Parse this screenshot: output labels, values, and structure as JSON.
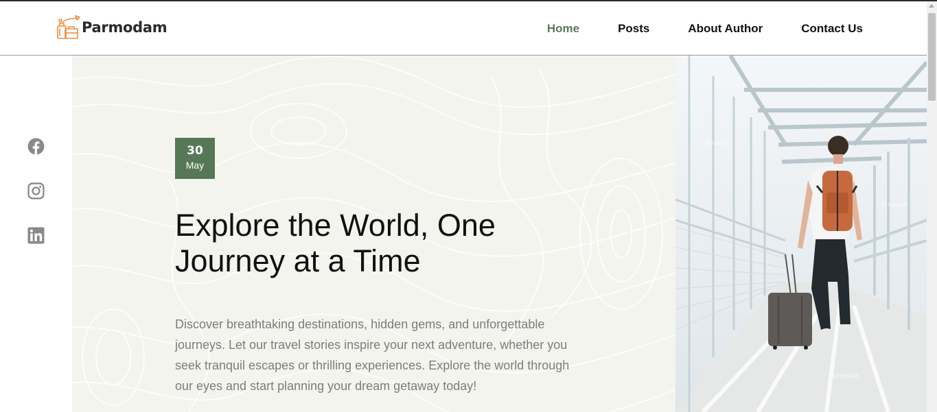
{
  "brand": {
    "name": "Parmodam",
    "icon": "travel-luggage-icon",
    "accent": "#f08a3c"
  },
  "nav": {
    "items": [
      {
        "label": "Home",
        "active": true
      },
      {
        "label": "Posts",
        "active": false
      },
      {
        "label": "About Author",
        "active": false
      },
      {
        "label": "Contact Us",
        "active": false
      }
    ]
  },
  "social": [
    {
      "icon": "facebook-icon"
    },
    {
      "icon": "instagram-icon"
    },
    {
      "icon": "linkedin-icon"
    }
  ],
  "hero": {
    "date": {
      "day": "30",
      "month": "May"
    },
    "title": "Explore the World, One Journey at a Time",
    "description": "Discover breathtaking destinations, hidden gems, and unforgettable journeys. Let our travel stories inspire your next adventure, whether you seek tranquil escapes or thrilling experiences. Explore the world through our eyes and start planning your dream getaway today!",
    "image_subject": "traveler-with-backpack-and-suitcase-on-bridge"
  },
  "colors": {
    "nav_active": "#5a7a57",
    "date_badge": "#577857",
    "hero_bg": "#f4f4ef",
    "text_muted": "#7c7c7c",
    "social_icon": "#8a8a8a"
  }
}
